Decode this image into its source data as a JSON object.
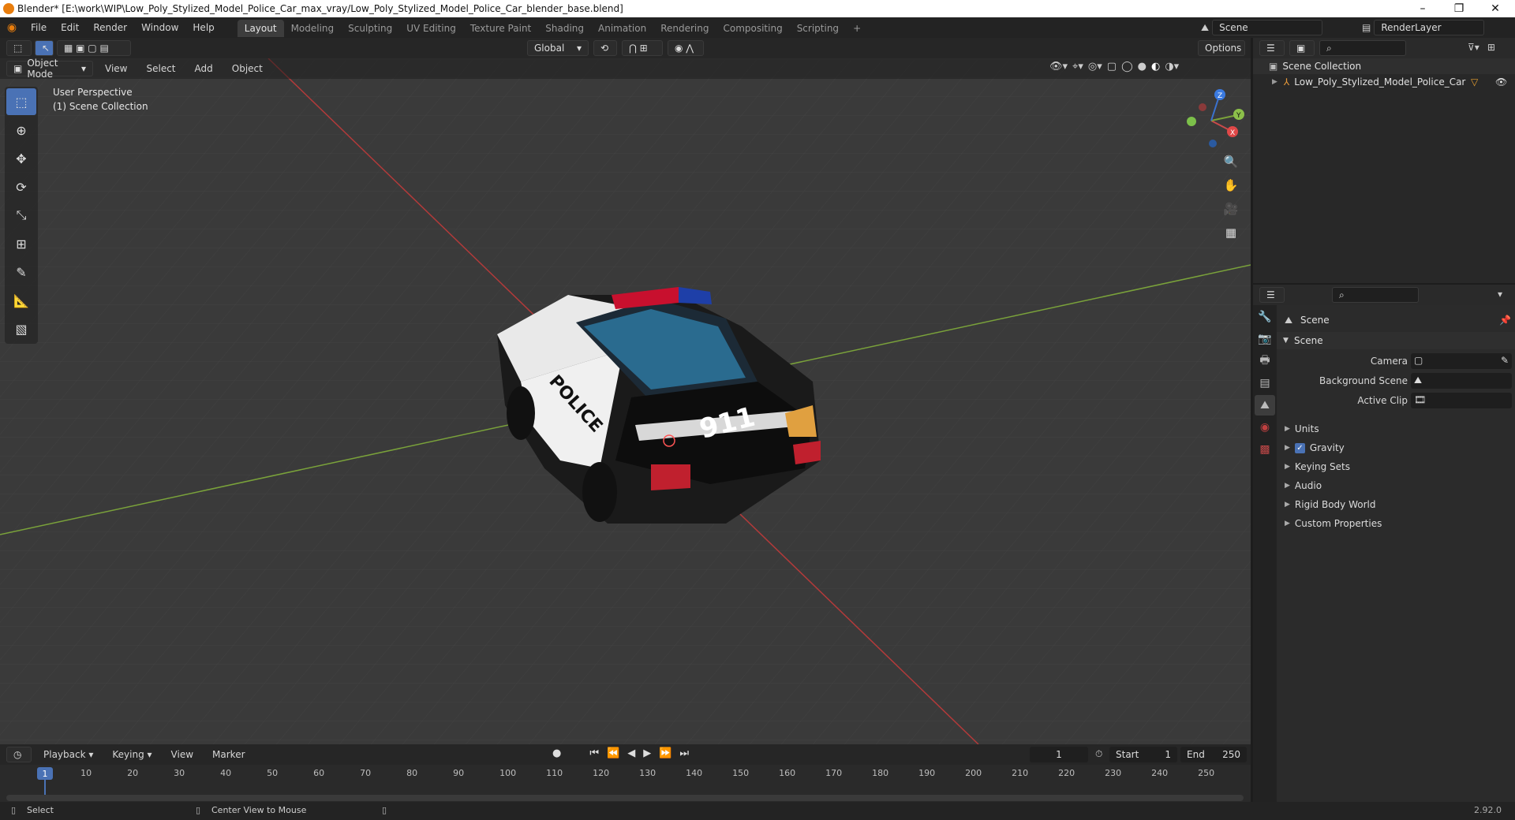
{
  "window": {
    "title": "Blender* [E:\\work\\WIP\\Low_Poly_Stylized_Model_Police_Car_max_vray/Low_Poly_Stylized_Model_Police_Car_blender_base.blend]",
    "minimize": "–",
    "maximize": "❐",
    "close": "✕"
  },
  "menu": [
    "File",
    "Edit",
    "Render",
    "Window",
    "Help"
  ],
  "workspaces": [
    "Layout",
    "Modeling",
    "Sculpting",
    "UV Editing",
    "Texture Paint",
    "Shading",
    "Animation",
    "Rendering",
    "Compositing",
    "Scripting"
  ],
  "active_workspace": "Layout",
  "add_workspace": "+",
  "scene_selector": {
    "value": "Scene"
  },
  "renderlayer_selector": {
    "value": "RenderLayer"
  },
  "viewport": {
    "transform_orientation": "Global",
    "options_label": "Options",
    "mode": "Object Mode",
    "header_menus": [
      "View",
      "Select",
      "Add",
      "Object"
    ],
    "perspective_label": "User Perspective",
    "collection_label": "(1) Scene Collection",
    "model_text": "911",
    "model_side_text": "POLICE",
    "gizmo": {
      "x": "X",
      "y": "Y",
      "z": "Z"
    },
    "colors": {
      "bg": "#3a3a3a",
      "x_axis": "#b33a3a",
      "y_axis": "#7aa23a"
    }
  },
  "outliner": {
    "root": "Scene Collection",
    "items": [
      {
        "name": "Low_Poly_Stylized_Model_Police_Car"
      }
    ]
  },
  "properties": {
    "context": "Scene",
    "panel": "Scene",
    "fields": [
      {
        "label": "Camera"
      },
      {
        "label": "Background Scene"
      },
      {
        "label": "Active Clip"
      }
    ],
    "subpanels": [
      "Units",
      "Gravity",
      "Keying Sets",
      "Audio",
      "Rigid Body World",
      "Custom Properties"
    ],
    "gravity_checked": true
  },
  "timeline": {
    "menus": [
      "Playback",
      "Keying",
      "View",
      "Marker"
    ],
    "current_frame": "1",
    "start_label": "Start",
    "start": "1",
    "end_label": "End",
    "end": "250",
    "ticks": [
      "1",
      "10",
      "20",
      "30",
      "40",
      "50",
      "60",
      "70",
      "80",
      "90",
      "100",
      "110",
      "120",
      "130",
      "140",
      "150",
      "160",
      "170",
      "180",
      "190",
      "200",
      "210",
      "220",
      "230",
      "240",
      "250"
    ]
  },
  "status": {
    "select": "Select",
    "center_view": "Center View to Mouse",
    "version": "2.92.0"
  }
}
